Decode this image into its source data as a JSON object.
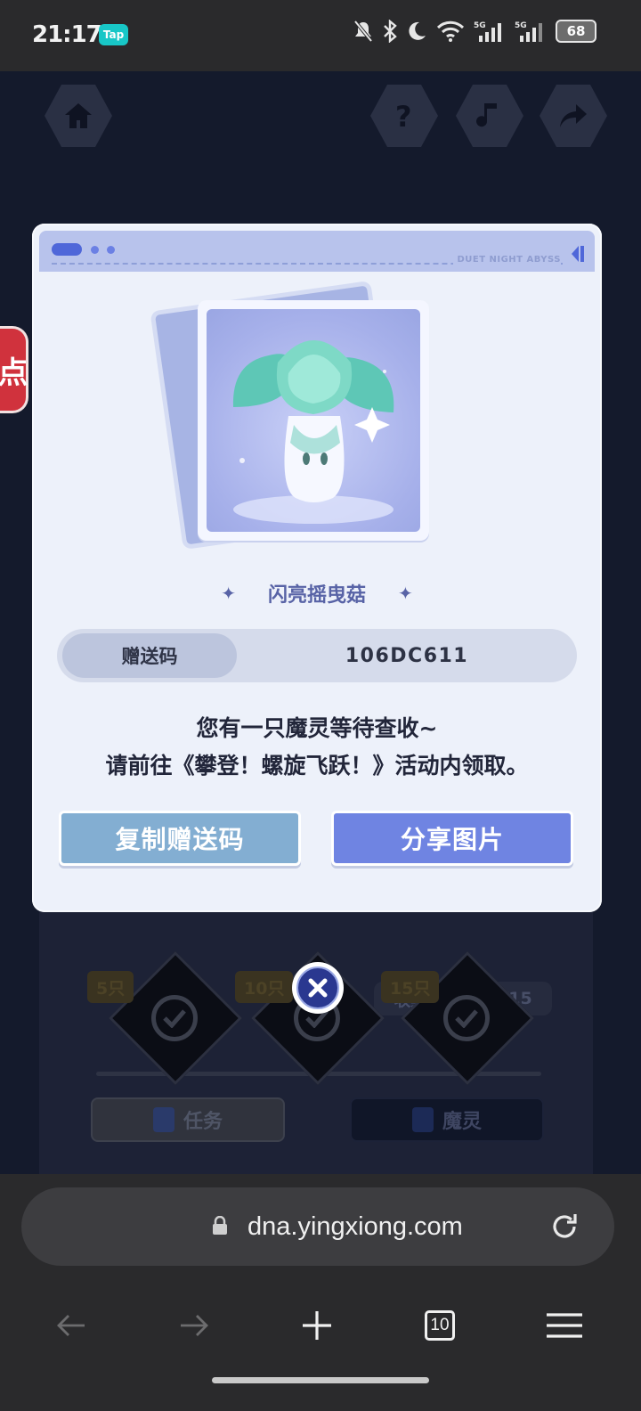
{
  "status_bar": {
    "time": "21:17",
    "tap_badge": "Tap",
    "battery": "68"
  },
  "background": {
    "side_tag": "点",
    "progress_label": "收集进度:",
    "progress_value": "15/15",
    "milestones": [
      "5只",
      "10只",
      "15只"
    ],
    "tabs": [
      "任务",
      "魔灵"
    ]
  },
  "modal": {
    "header_brand": "DUET NIGHT ABYSS",
    "spirit_name": "闪亮摇曳菇",
    "code_label": "赠送码",
    "code_value": "106DC611",
    "message_line1": "您有一只魔灵等待查收~",
    "message_line2": "请前往《攀登！螺旋飞跃！》活动内领取。",
    "copy_button": "复制赠送码",
    "share_button": "分享图片"
  },
  "browser": {
    "url": "dna.yingxiong.com",
    "tab_count": "10"
  },
  "colors": {
    "modal_bg": "#edf1fa",
    "copy_button": "#83aed2",
    "share_button": "#6f84e2",
    "code_bar": "#d5dbeb",
    "close_button": "#2a3890"
  }
}
